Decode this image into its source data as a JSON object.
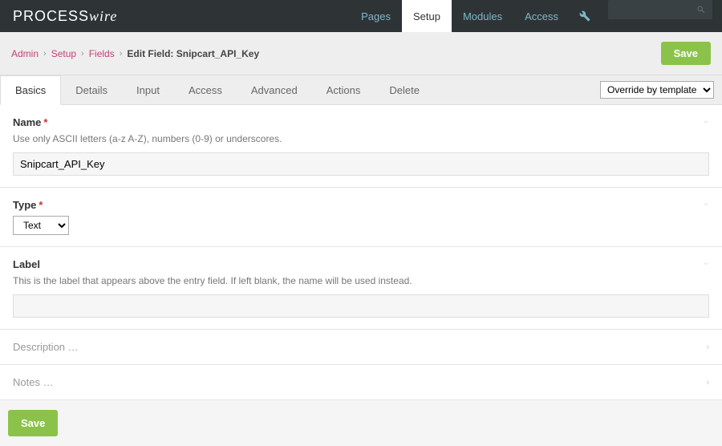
{
  "logo": {
    "p1": "PROCESS",
    "p2": "wire"
  },
  "nav": {
    "items": [
      "Pages",
      "Setup",
      "Modules",
      "Access"
    ],
    "active": 1
  },
  "breadcrumb": {
    "crumbs": [
      "Admin",
      "Setup",
      "Fields"
    ],
    "current": "Edit Field: Snipcart_API_Key",
    "save": "Save"
  },
  "tabs": {
    "items": [
      "Basics",
      "Details",
      "Input",
      "Access",
      "Advanced",
      "Actions",
      "Delete"
    ],
    "active": 0,
    "override": "Override by template"
  },
  "fields": {
    "name": {
      "label": "Name",
      "desc": "Use only ASCII letters (a-z A-Z), numbers (0-9) or underscores.",
      "value": "Snipcart_API_Key"
    },
    "type": {
      "label": "Type",
      "value": "Text"
    },
    "label": {
      "label": "Label",
      "desc": "This is the label that appears above the entry field. If left blank, the name will be used instead.",
      "value": ""
    },
    "description": {
      "label": "Description …"
    },
    "notes": {
      "label": "Notes …"
    }
  },
  "bottom_save": "Save"
}
